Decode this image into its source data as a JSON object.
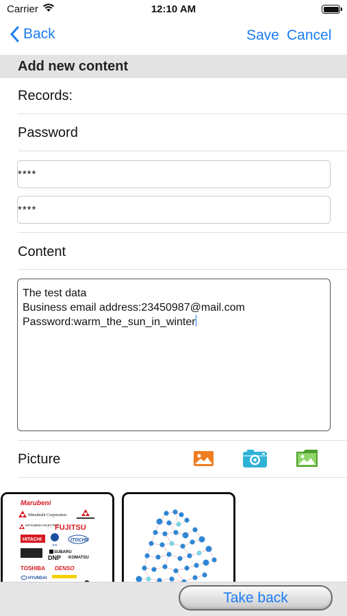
{
  "status_bar": {
    "carrier": "Carrier",
    "time": "12:10 AM"
  },
  "nav": {
    "back_label": "Back",
    "save_label": "Save",
    "cancel_label": "Cancel"
  },
  "section": {
    "title": "Add new content"
  },
  "form": {
    "records_label": "Records:",
    "password_label": "Password",
    "password_value": "****",
    "password_confirm_value": "****",
    "content_label": "Content",
    "content_lines": [
      "The test data",
      "Business email address:23450987@mail.com",
      "Password:warm_the_sun_in_winter"
    ],
    "picture_label": "Picture"
  },
  "thumbnail_1": {
    "logos": [
      "Marubeni",
      "Mitsubishi Corporation",
      "MITSUBISHI ELECTRIC",
      "FUJITSU",
      "HITACHI",
      "JFE",
      "ITOCHU",
      "SUBARU",
      "DNP",
      "KOMATSU",
      "TOSHIBA",
      "DENSO",
      "HYUNDAI"
    ]
  },
  "bottom": {
    "take_back_label": "Take back"
  },
  "colors": {
    "accent": "#1a7cf5",
    "section_bg": "#e3e3e3",
    "icon_orange": "#ef7d22",
    "icon_teal": "#2fb2d6",
    "icon_green": "#6cc24a"
  }
}
